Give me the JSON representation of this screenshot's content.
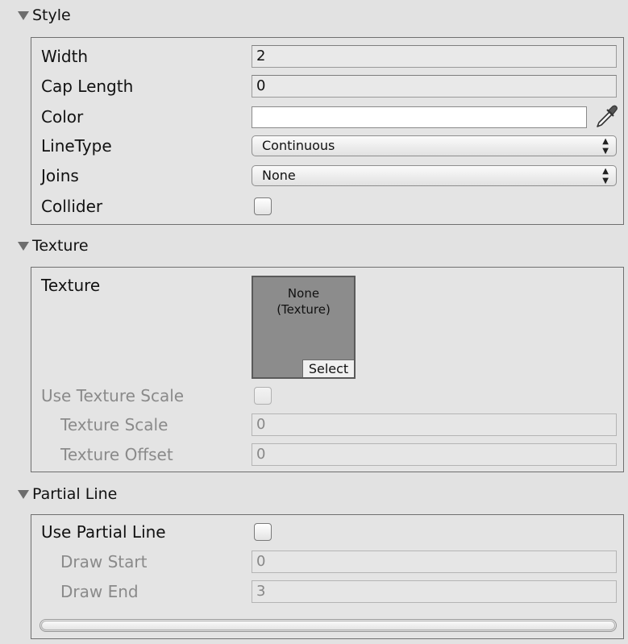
{
  "sections": {
    "style": {
      "title": "Style",
      "width_label": "Width",
      "width_value": "2",
      "cap_length_label": "Cap Length",
      "cap_length_value": "0",
      "color_label": "Color",
      "color_value": "#ffffff",
      "line_type_label": "LineType",
      "line_type_value": "Continuous",
      "joins_label": "Joins",
      "joins_value": "None",
      "collider_label": "Collider",
      "collider_checked": false
    },
    "texture": {
      "title": "Texture",
      "texture_label": "Texture",
      "texture_none_line1": "None",
      "texture_none_line2": "(Texture)",
      "select_label": "Select",
      "use_texture_scale_label": "Use Texture Scale",
      "use_texture_scale_checked": false,
      "texture_scale_label": "Texture Scale",
      "texture_scale_value": "0",
      "texture_offset_label": "Texture Offset",
      "texture_offset_value": "0"
    },
    "partial_line": {
      "title": "Partial Line",
      "use_partial_line_label": "Use Partial Line",
      "use_partial_line_checked": false,
      "draw_start_label": "Draw Start",
      "draw_start_value": "0",
      "draw_end_label": "Draw End",
      "draw_end_value": "3"
    }
  },
  "icons": {
    "foldout": "triangle-down-icon",
    "eyedropper": "eyedropper-icon",
    "dropdown_arrows": "up-down-arrows-icon"
  }
}
